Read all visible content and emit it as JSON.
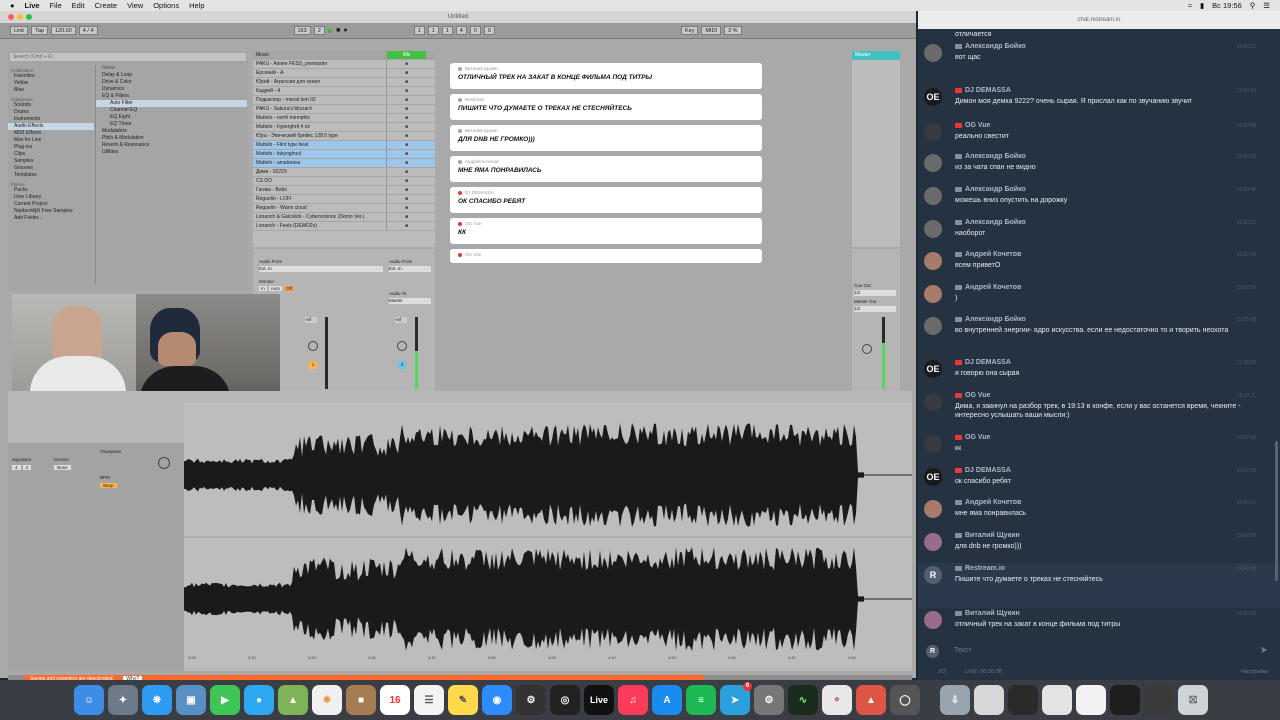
{
  "menubar": {
    "apple": "",
    "app": "Live",
    "items": [
      "File",
      "Edit",
      "Create",
      "View",
      "Options",
      "Help"
    ],
    "clock": "Вс 19:56"
  },
  "ableton": {
    "title": "Untitled",
    "transport": {
      "link": "Link",
      "tap": "Tap",
      "tempo": "120.00",
      "sig": "4 / 4",
      "bar_a": "153",
      "bar_b": "2",
      "pos_a": "1",
      "pos_b": "1",
      "pos_c": "1",
      "loop_a": "4",
      "loop_b": "0",
      "loop_c": "0",
      "key": "Key",
      "midi": "MIDI",
      "cpu": "3 %"
    },
    "browser": {
      "search": "Search (Cmd + F)",
      "collections_head": "Collections",
      "collections": [
        "Favorites",
        "Yellow",
        "Blue"
      ],
      "categories_head": "Categories",
      "categories": [
        "Sounds",
        "Drums",
        "Instruments",
        "Audio Effects",
        "MIDI Effects",
        "Max for Live",
        "Plug-ins",
        "Clips",
        "Samples",
        "Grooves",
        "Templates"
      ],
      "places_head": "Places",
      "places": [
        "Packs",
        "User Library",
        "Current Project",
        "Nejdavnější Free Samples",
        "Add Folder..."
      ],
      "name_head": "Name",
      "folders": [
        "Delay & Loop",
        "Drive & Color",
        "Dynamics",
        "EQ & Filters",
        "Auto Filter",
        "Channel EQ",
        "EQ Eight",
        "EQ Three",
        "Modulators",
        "Pitch & Modulation",
        "Reverb & Resonance",
        "Utilities"
      ]
    },
    "tracks": {
      "header": "Music",
      "mic_header": "Mic",
      "rows": [
        "PAKU - Aimee FESS_premaster",
        "Ерсений - A",
        "Юрий - Агрессия для хенил",
        "Кадрей - 4",
        "Подкаспер - menal tem 02",
        "PAKU - Sakura's blizzard",
        "Mattelo - north memphis",
        "Mattelo - hyperghrit 4 ox",
        "Юра - Эпический брейкс 128.5 type",
        "Mattelo - Flint type beat",
        "Mattelo - tokyoghoul",
        "Mattelo - amaterasu",
        "Дима - 92229",
        "CS DO",
        "Гагика - Bobs",
        "Reguelin - LOFI",
        "Reguelin - Warm cloud",
        "Lonanch & Galcolick - Cyberscience (Demo Ver.)",
        "Lonanch - Feels (DEMO2s)"
      ],
      "master": "Master",
      "audio_from": "Audio From",
      "ext_in": "Ext. In",
      "monitor": "Monitor",
      "in": "In",
      "auto": "Auto",
      "off": "Off",
      "audio_to": "Audio To",
      "master_out": "Master",
      "cue_out": "Cue Out",
      "cue_val": "1/2",
      "master_out_label": "Master Out",
      "master_out_val": "1/2",
      "gain_a": "-inf",
      "gain_b": "-inf",
      "ch_a": "1",
      "ch_b": "2"
    },
    "clip": {
      "signature": "Signature",
      "groove": "Groove",
      "sig_a": "4",
      "sig_b": "4",
      "groove_val": "None",
      "transpose": "Transpose",
      "bpm": "BPM",
      "warp": "Warp",
      "ruler": [
        "3:00",
        "3:10",
        "3:20",
        "3:30",
        "3:40",
        "3:50",
        "4:00",
        "4:10",
        "4:20",
        "4:30",
        "4:40",
        "4:50"
      ]
    },
    "status": "Saving and exporting are deactivated.",
    "status_link": "Why?"
  },
  "overlay": [
    {
      "author": "Виталий Щукин",
      "text": "Отличный трек на закат в конце фильма под титры",
      "yt": false
    },
    {
      "author": "Restream",
      "text": "Пишите что думаете о треках не стесняйтесь",
      "yt": false
    },
    {
      "author": "Виталий Щукин",
      "text": "для dnb не громко)))",
      "yt": false
    },
    {
      "author": "Андрей Кочетов",
      "text": "мне яма понравилась",
      "yt": false
    },
    {
      "author": "DJ DEMASSA",
      "text": "ок спасибо ребят",
      "yt": true
    },
    {
      "author": "OG Vue",
      "text": "кк",
      "yt": true
    },
    {
      "author": "OG Vue",
      "text": "",
      "yt": true
    }
  ],
  "chat": {
    "url": "chat.restream.io",
    "messages": [
      {
        "name": "",
        "text": "отличается",
        "av": "",
        "yt": false,
        "time": ""
      },
      {
        "name": "Александр Бойко",
        "text": "вот щас",
        "av": "",
        "yt": false,
        "time": "19:29:22"
      },
      {
        "name": "DJ DEMASSA",
        "text": "Димон моя демка 9222? очень сырая. Я прислал как по звучанию звучит",
        "av": "OE",
        "yt": true,
        "time": "19:29:43"
      },
      {
        "name": "OG Vue",
        "text": "реально свестит",
        "av": "",
        "yt": true,
        "time": "19:29:58"
      },
      {
        "name": "Александр Бойко",
        "text": "из за чата спан не видно",
        "av": "",
        "yt": false,
        "time": "19:29:35"
      },
      {
        "name": "Александр Бойко",
        "text": "можешь вниз опустить на дорожку",
        "av": "",
        "yt": false,
        "time": "19:29:46"
      },
      {
        "name": "Александр Бойко",
        "text": "наоборот",
        "av": "",
        "yt": false,
        "time": "19:30:22"
      },
      {
        "name": "Андрей Кочетов",
        "text": "всем приветО",
        "av": "",
        "yt": false,
        "time": "19:32:54"
      },
      {
        "name": "Андрей Кочетов",
        "text": ")",
        "av": "",
        "yt": false,
        "time": "19:32:59"
      },
      {
        "name": "Александр Бойко",
        "text": "во внутренней энергии- ядро искусства. если ее недостаточно то и творить неохота",
        "av": "",
        "yt": false,
        "time": "19:35:48"
      },
      {
        "name": "DJ DEMASSA",
        "text": "я говорю она сырая",
        "av": "OE",
        "yt": true,
        "time": "19:36:26"
      },
      {
        "name": "OG Vue",
        "text": "Дима, я закинул на разбор трек, в 19:13 в конфе, если у вас останется время, чекните - интересно услышать ваши мысли:)",
        "av": "",
        "yt": true,
        "time": "19:37:11"
      },
      {
        "name": "OG Vue",
        "text": "кк",
        "av": "",
        "yt": true,
        "time": "19:37:42"
      },
      {
        "name": "DJ DEMASSA",
        "text": "ок спасибо ребят",
        "av": "OE",
        "yt": true,
        "time": "19:37:58"
      },
      {
        "name": "Андрей Кочетов",
        "text": "мне яма понравилась",
        "av": "",
        "yt": false,
        "time": "19:43:12"
      },
      {
        "name": "Виталий Щукин",
        "text": "для dnb не громко)))",
        "av": "",
        "yt": false,
        "time": "19:42:58"
      },
      {
        "name": "Restream.io",
        "text": "Пишите что думаете о треках не стесняйтесь",
        "av": "R",
        "yt": false,
        "time": "19:48:39"
      },
      {
        "name": "Виталий Щукин",
        "text": "отличный трек на закат в конце фильма под титры",
        "av": "",
        "yt": false,
        "time": "19:50:26"
      }
    ],
    "input_placeholder": "Текст",
    "input_avatar": "R",
    "foot_left": "3/3",
    "foot_live": "LIVE: 00:10:38",
    "settings": "Настройки"
  },
  "dock": {
    "live": "Live",
    "calendar_day": "16",
    "badge": "6"
  },
  "colors": {
    "chat_bg": "#243242",
    "accent_green": "#43c043",
    "status_orange": "#ff6a2e",
    "youtube_red": "#e53935"
  }
}
